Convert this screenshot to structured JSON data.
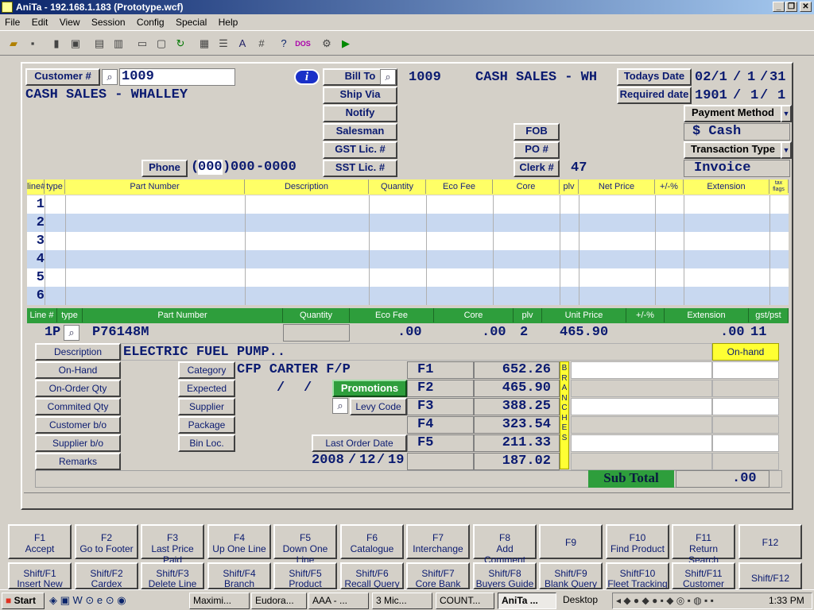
{
  "window": {
    "title": "AniTa -  192.168.1.183 (Prototype.wcf)",
    "btn_min": "_",
    "btn_restore": "❐",
    "btn_close": "✕"
  },
  "menu": [
    "File",
    "Edit",
    "View",
    "Session",
    "Config",
    "Special",
    "Help"
  ],
  "header": {
    "customer_label": "Customer #",
    "customer_no": "1009",
    "customer_name": "CASH SALES - WHALLEY",
    "info_icon": "i",
    "bill_to": "Bill To",
    "bill_to_no": "1009",
    "bill_to_name": "CASH SALES - WH",
    "ship_via": "Ship Via",
    "notify": "Notify",
    "salesman": "Salesman",
    "gst": "GST Lic. #",
    "sst": "SST Lic. #",
    "phone_label": "Phone",
    "phone_area": "000",
    "phone_pre": "000",
    "phone_num": "0000",
    "fob": "FOB",
    "po": "PO #",
    "clerk": "Clerk #",
    "clerk_no": "47",
    "todays_date_label": "Todays Date",
    "td_a": "02/1",
    "td_b": "1",
    "td_c": "31",
    "required_date_label": "Required date",
    "rd_a": "1901",
    "rd_b": "1",
    "rd_c": "1",
    "payment_method_label": "Payment Method",
    "payment_method": "$ Cash",
    "transaction_type_label": "Transaction Type",
    "transaction_type": "Invoice"
  },
  "lines_table": {
    "headers": [
      "line#",
      "type",
      "Part Number",
      "Description",
      "Quantity",
      "Eco Fee",
      "Core",
      "plv",
      "Net Price",
      "+/-%",
      "Extension",
      "tax flags"
    ],
    "row_numbers": [
      "1",
      "2",
      "3",
      "4",
      "5",
      "6"
    ]
  },
  "detail": {
    "headers": [
      "Line #",
      "type",
      "Part Number",
      "Quantity",
      "Eco Fee",
      "Core",
      "plv",
      "Unit Price",
      "+/-%",
      "Extension",
      "gst/pst"
    ],
    "line_no": "1",
    "type": "P",
    "part_number": "P76148M",
    "eco_fee": ".00",
    "core": ".00",
    "plv": "2",
    "unit_price": "465.90",
    "extension": ".00",
    "gst_pst": "11",
    "description_label": "Description",
    "description": "ELECTRIC FUEL PUMP..",
    "onhand_header": "On-hand",
    "left_buttons": [
      "On-Hand",
      "On-Order Qty",
      "Commited Qty",
      "Customer b/o",
      "Supplier b/o",
      "Remarks"
    ],
    "mid_buttons": [
      "Category",
      "Expected",
      "Supplier",
      "Package",
      "Bin Loc."
    ],
    "category_value": "CFP CARTER F/P",
    "promotions": "Promotions",
    "levy_code": "Levy Code",
    "last_order_date_label": "Last Order Date",
    "last_order_date": "2008",
    "lod_m": "12",
    "lod_d": "19",
    "price_levels": [
      {
        "key": "F1",
        "value": "652.26"
      },
      {
        "key": "F2",
        "value": "465.90"
      },
      {
        "key": "F3",
        "value": "388.25"
      },
      {
        "key": "F4",
        "value": "323.54"
      },
      {
        "key": "F5",
        "value": "211.33"
      },
      {
        "key": "",
        "value": "187.02"
      }
    ],
    "branches_label": "BRANCHES",
    "subtotal_label": "Sub Total",
    "subtotal": ".00"
  },
  "fkeys": [
    {
      "k": "F1",
      "l": "Accept"
    },
    {
      "k": "F2",
      "l": "Go to Footer"
    },
    {
      "k": "F3",
      "l": "Last Price Paid"
    },
    {
      "k": "F4",
      "l": "Up One Line"
    },
    {
      "k": "F5",
      "l": "Down One Line"
    },
    {
      "k": "F6",
      "l": "Catalogue"
    },
    {
      "k": "F7",
      "l": "Interchange"
    },
    {
      "k": "F8",
      "l": "Add Comment"
    },
    {
      "k": "F9",
      "l": ""
    },
    {
      "k": "F10",
      "l": "Find Product"
    },
    {
      "k": "F11",
      "l": "Return Search"
    },
    {
      "k": "F12",
      "l": ""
    }
  ],
  "shift_fkeys": [
    {
      "k": "Shift/F1",
      "l": "Insert New Line"
    },
    {
      "k": "Shift/F2",
      "l": "Cardex Search"
    },
    {
      "k": "Shift/F3",
      "l": "Delete Line"
    },
    {
      "k": "Shift/F4",
      "l": "Branch Inquiry"
    },
    {
      "k": "Shift/F5",
      "l": "Product Inquiry"
    },
    {
      "k": "Shift/F6",
      "l": "Recall Query"
    },
    {
      "k": "Shift/F7",
      "l": "Core Bank Inq."
    },
    {
      "k": "Shift/F8",
      "l": "Buyers Guide"
    },
    {
      "k": "Shift/F9",
      "l": "Blank Query"
    },
    {
      "k": "ShiftF10",
      "l": "Fleet Tracking"
    },
    {
      "k": "Shift/F11",
      "l": "Customer Note"
    },
    {
      "k": "Shift/F12",
      "l": ""
    }
  ],
  "taskbar": {
    "start": "Start",
    "tasks": [
      "Maximi...",
      "Eudora...",
      "AAA - ...",
      "3 Mic...",
      "COUNT...",
      "AniTa ..."
    ],
    "desktop": "Desktop",
    "clock": "1:33 PM"
  }
}
